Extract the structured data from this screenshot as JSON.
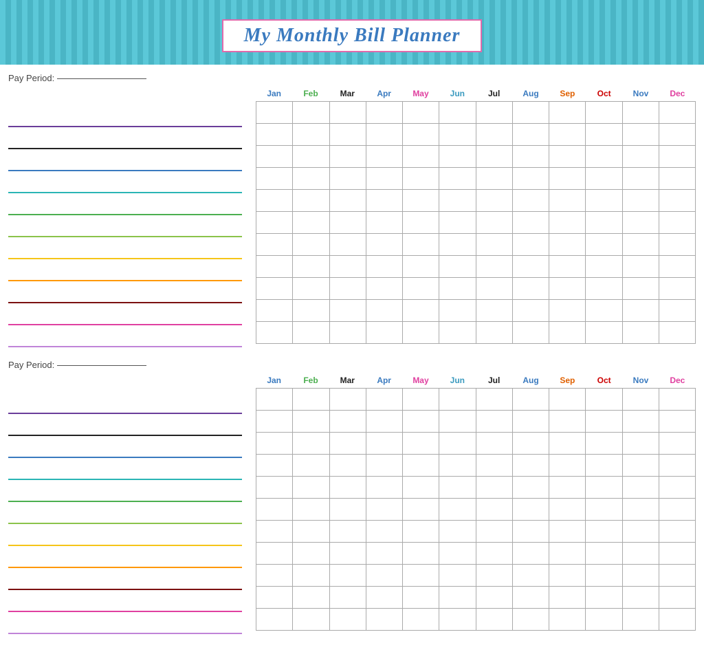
{
  "header": {
    "title": "My Monthly Bill Planner"
  },
  "months": [
    {
      "label": "Jan",
      "colorClass": "m-jan"
    },
    {
      "label": "Feb",
      "colorClass": "m-feb"
    },
    {
      "label": "Mar",
      "colorClass": "m-mar"
    },
    {
      "label": "Apr",
      "colorClass": "m-apr"
    },
    {
      "label": "May",
      "colorClass": "m-may"
    },
    {
      "label": "Jun",
      "colorClass": "m-jun"
    },
    {
      "label": "Jul",
      "colorClass": "m-jul"
    },
    {
      "label": "Aug",
      "colorClass": "m-aug"
    },
    {
      "label": "Sep",
      "colorClass": "m-sep"
    },
    {
      "label": "Oct",
      "colorClass": "m-oct"
    },
    {
      "label": "Nov",
      "colorClass": "m-nov"
    },
    {
      "label": "Dec",
      "colorClass": "m-dec"
    }
  ],
  "sections": [
    {
      "pay_period_label": "Pay Period:",
      "pay_period_blank": "________________",
      "rows": 11,
      "line_colors": [
        "line-purple",
        "line-black",
        "line-blue",
        "line-teal",
        "line-green",
        "line-lime",
        "line-yellow",
        "line-orange",
        "line-darkred",
        "line-pink",
        "line-lavender"
      ]
    },
    {
      "pay_period_label": "Pay Period:",
      "pay_period_blank": "________________",
      "rows": 11,
      "line_colors": [
        "line-purple",
        "line-black",
        "line-blue",
        "line-teal",
        "line-green",
        "line-lime",
        "line-yellow",
        "line-orange",
        "line-darkred",
        "line-pink",
        "line-lavender"
      ]
    }
  ]
}
